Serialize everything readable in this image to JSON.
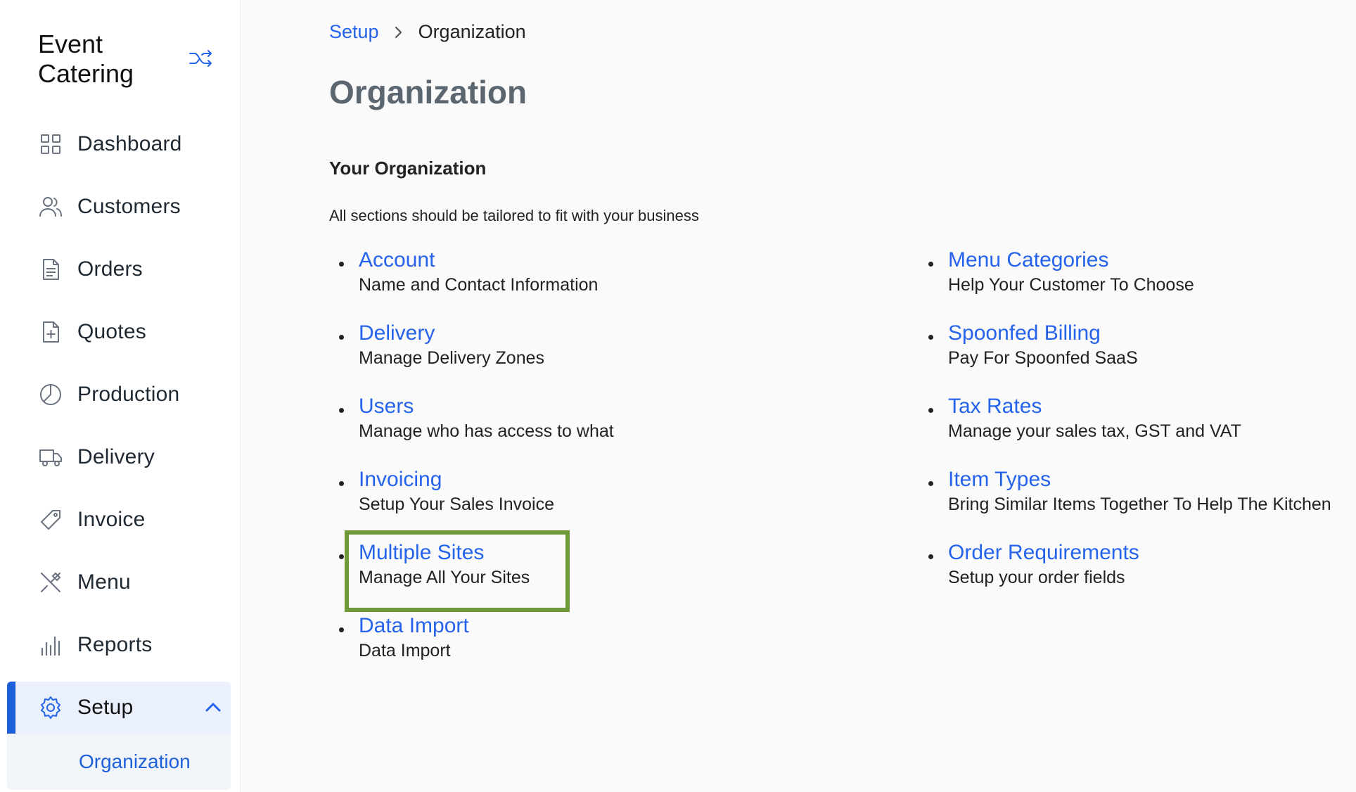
{
  "sidebar": {
    "brand": "Event Catering",
    "toggle_icon": "shuffle-icon",
    "items": [
      {
        "label": "Dashboard",
        "icon": "grid-icon"
      },
      {
        "label": "Customers",
        "icon": "users-icon"
      },
      {
        "label": "Orders",
        "icon": "document-icon"
      },
      {
        "label": "Quotes",
        "icon": "file-plus-icon"
      },
      {
        "label": "Production",
        "icon": "pie-chart-icon"
      },
      {
        "label": "Delivery",
        "icon": "truck-icon"
      },
      {
        "label": "Invoice",
        "icon": "tag-icon"
      },
      {
        "label": "Menu",
        "icon": "utensils-icon"
      },
      {
        "label": "Reports",
        "icon": "bar-chart-icon"
      },
      {
        "label": "Setup",
        "icon": "gear-icon",
        "active": true
      }
    ],
    "subitems": [
      {
        "label": "Organization",
        "active": true
      }
    ],
    "accent_color": "#1d5fd8"
  },
  "breadcrumb": {
    "parent": "Setup",
    "current": "Organization"
  },
  "page": {
    "title": "Organization",
    "section_title": "Your Organization",
    "section_desc": "All sections should be tailored to fit with your business"
  },
  "left_items": [
    {
      "title": "Account",
      "desc": "Name and Contact Information"
    },
    {
      "title": "Delivery",
      "desc": "Manage Delivery Zones"
    },
    {
      "title": "Users",
      "desc": "Manage who has access to what"
    },
    {
      "title": "Invoicing",
      "desc": "Setup Your Sales Invoice"
    },
    {
      "title": "Multiple Sites",
      "desc": "Manage All Your Sites",
      "highlighted": true
    },
    {
      "title": "Data Import",
      "desc": "Data Import"
    }
  ],
  "right_items": [
    {
      "title": "Menu Categories",
      "desc": "Help Your Customer To Choose"
    },
    {
      "title": "Spoonfed Billing",
      "desc": "Pay For Spoonfed SaaS"
    },
    {
      "title": "Tax Rates",
      "desc": "Manage your sales tax, GST and VAT"
    },
    {
      "title": "Item Types",
      "desc": "Bring Similar Items Together To Help The Kitchen"
    },
    {
      "title": "Order Requirements",
      "desc": "Setup your order fields"
    }
  ],
  "colors": {
    "link": "#2563eb",
    "highlight_border": "#6e9a3a",
    "title_gray": "#5b6670"
  }
}
